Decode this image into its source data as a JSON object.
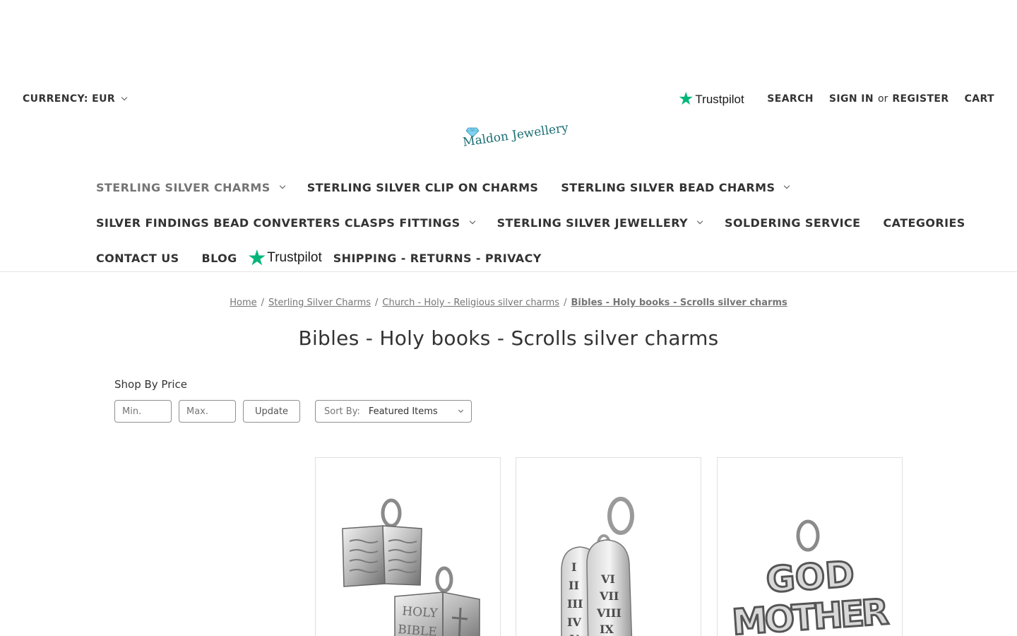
{
  "header": {
    "currency_label": "CURRENCY: EUR",
    "trustpilot": "Trustpilot",
    "search": "SEARCH",
    "sign_in": "SIGN IN",
    "or": "or",
    "register": "REGISTER",
    "cart": "CART"
  },
  "logo": {
    "text": "Maldon Jewellery"
  },
  "nav": {
    "row1": [
      "STERLING SILVER CHARMS",
      "STERLING SILVER CLIP ON CHARMS",
      "STERLING SILVER BEAD CHARMS"
    ],
    "row2": [
      "SILVER FINDINGS BEAD CONVERTERS CLASPS FITTINGS",
      "STERLING SILVER JEWELLERY",
      "SOLDERING SERVICE",
      "CATEGORIES"
    ],
    "row3": [
      "CONTACT US",
      "BLOG",
      "SHIPPING - RETURNS - PRIVACY"
    ],
    "trustpilot": "Trustpilot"
  },
  "breadcrumb": [
    "Home",
    "Sterling Silver Charms",
    "Church - Holy - Religious silver charms",
    "Bibles - Holy books - Scrolls silver charms"
  ],
  "page_title": "Bibles - Holy books - Scrolls silver charms",
  "filters": {
    "heading": "Shop By Price",
    "min_placeholder": "Min.",
    "max_placeholder": "Max.",
    "update": "Update",
    "sort_label": "Sort By:",
    "sort_value": "Featured Items"
  },
  "products": {
    "card1": {
      "book_text": [
        "HOLY",
        "BIBLE"
      ]
    },
    "card2": {
      "numerals_left": [
        "I",
        "II",
        "III",
        "IV",
        "V"
      ],
      "numerals_right": [
        "VI",
        "VII",
        "VIII",
        "IX"
      ]
    },
    "card3": {
      "word1": "GOD",
      "word2": "MOTHER"
    }
  },
  "colors": {
    "trustpilot_green": "#00b67a",
    "logo_teal": "#1c6f73",
    "active_nav": "#757575"
  }
}
